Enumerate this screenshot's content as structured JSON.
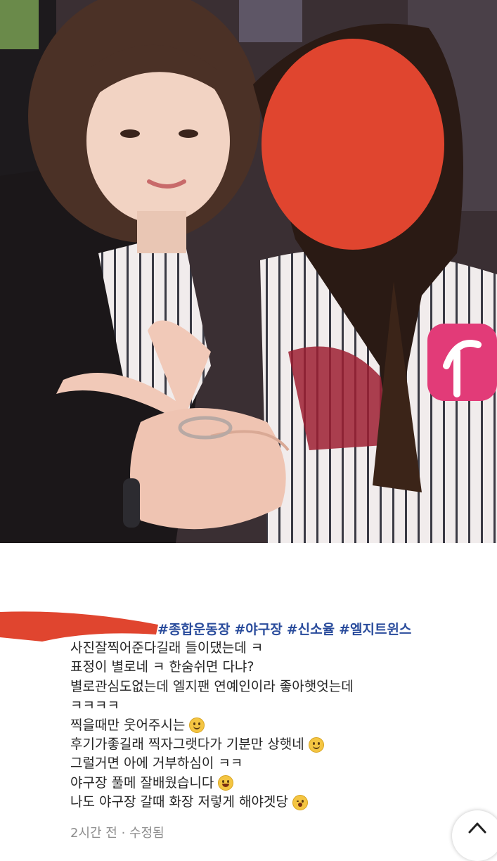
{
  "post": {
    "hashtags": [
      "#종합운동장",
      "#야구장",
      "#신소율",
      "#엘지트윈스"
    ],
    "caption_lines": [
      {
        "text": "사진잘찍어준다길래 들이댔는데 ㅋ",
        "emoji": ""
      },
      {
        "text": "표정이 별로네 ㅋ 한숨쉬면 다냐?",
        "emoji": ""
      },
      {
        "text": "별로관심도없는데 엘지팬 연예인이라 좋아햇엇는데",
        "emoji": ""
      },
      {
        "text": "ㅋㅋㅋㅋ",
        "emoji": ""
      },
      {
        "text": "찍을때만 웃어주시는",
        "emoji": "slightly-smiling-emoji"
      },
      {
        "text": "후기가좋길래 찍자그랫다가 기분만 상햇네",
        "emoji": "smiling-emoji"
      },
      {
        "text": "그럴거면 아에 거부하심이 ㅋㅋ",
        "emoji": ""
      },
      {
        "text": "야구장 풀메 잘배웠습니다",
        "emoji": "laughing-emoji"
      },
      {
        "text": "나도 야구장 갈때 화장 저렇게 해야겟당",
        "emoji": "winking-emoji"
      }
    ],
    "meta": "2시간 전 · 수정됨"
  },
  "colors": {
    "hashtag": "#2a4c9c",
    "redaction": "#e0452f",
    "text": "#262626",
    "meta": "#8e8e8e"
  },
  "icons": {
    "scroll_top": "chevron-up-icon"
  }
}
